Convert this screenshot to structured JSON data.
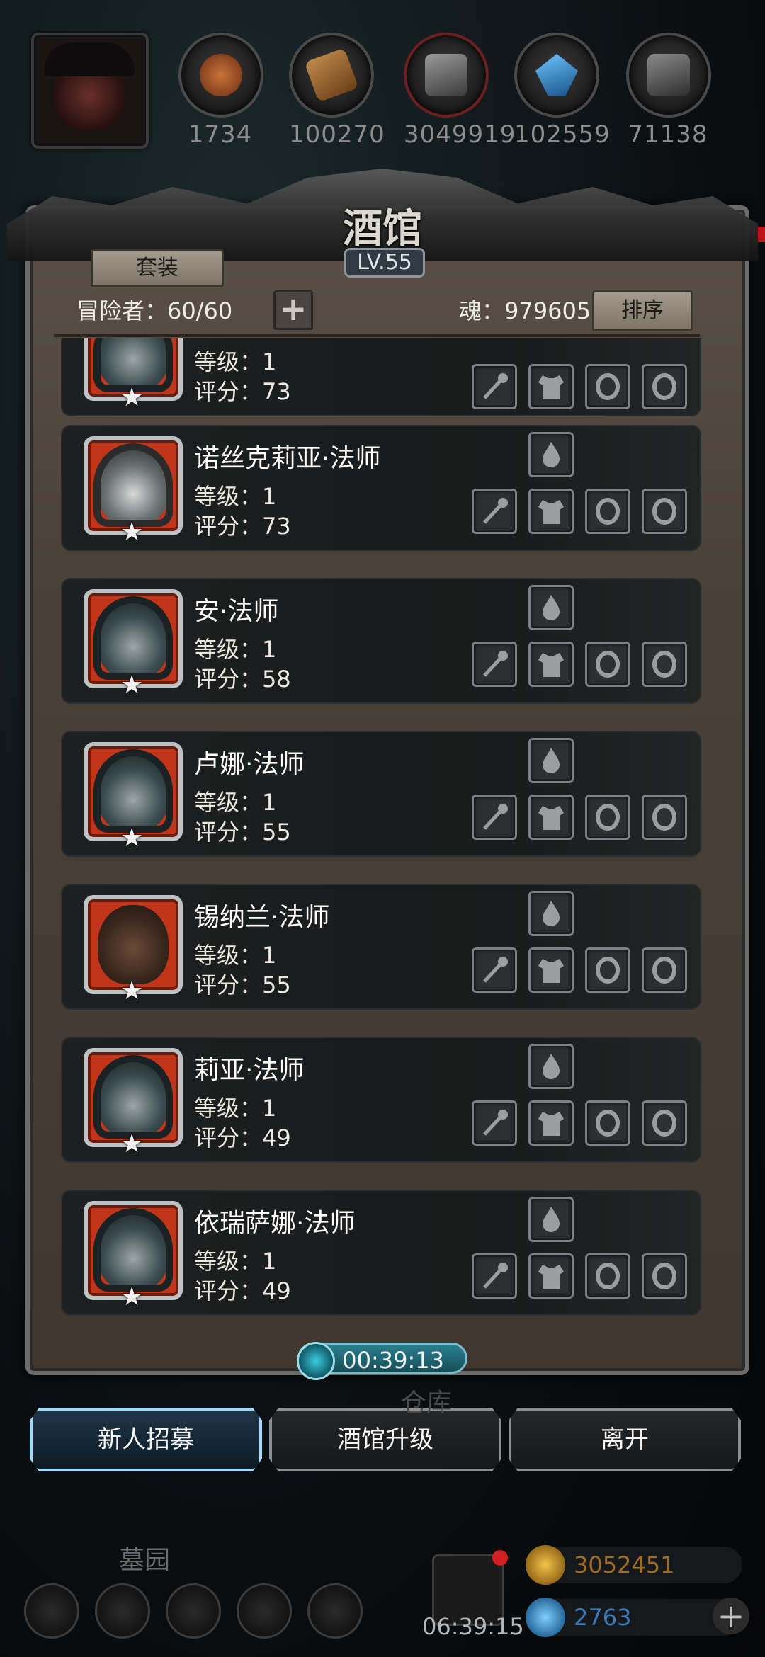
{
  "resources": [
    {
      "icon": "meat-icon",
      "value": "1734",
      "color": "#a8542a"
    },
    {
      "icon": "wood-icon",
      "value": "100270",
      "color": "#a86a2e"
    },
    {
      "icon": "iron-ingot-icon",
      "value": "3049919",
      "color": "#6f6f6f"
    },
    {
      "icon": "crystal-icon",
      "value": "102559",
      "color": "#2f8fd6"
    },
    {
      "icon": "steel-ingot-icon",
      "value": "71138",
      "color": "#5e5e5e"
    }
  ],
  "panel": {
    "title": "酒馆",
    "level": "LV.55",
    "set_button": "套装",
    "adventurers_label": "冒险者：60/60",
    "soul_label": "魂：979605",
    "sort_button": "排序"
  },
  "heroes": [
    {
      "name": "",
      "level": "等级：1",
      "score": "评分：73"
    },
    {
      "name": "诺丝克莉亚·法师",
      "level": "等级：1",
      "score": "评分：73"
    },
    {
      "name": "安·法师",
      "level": "等级：1",
      "score": "评分：58"
    },
    {
      "name": "卢娜·法师",
      "level": "等级：1",
      "score": "评分：55"
    },
    {
      "name": "锡纳兰·法师",
      "level": "等级：1",
      "score": "评分：55"
    },
    {
      "name": "莉亚·法师",
      "level": "等级：1",
      "score": "评分：49"
    },
    {
      "name": "依瑞萨娜·法师",
      "level": "等级：1",
      "score": "评分：49"
    }
  ],
  "timer": "00:39:13",
  "buttons": {
    "recruit": "新人招募",
    "upgrade": "酒馆升级",
    "leave": "离开"
  },
  "hud": {
    "warehouse_label": "仓库",
    "cemetery_label": "墓园",
    "gold": "3052451",
    "gems": "2763",
    "clock": "06:39:15"
  }
}
